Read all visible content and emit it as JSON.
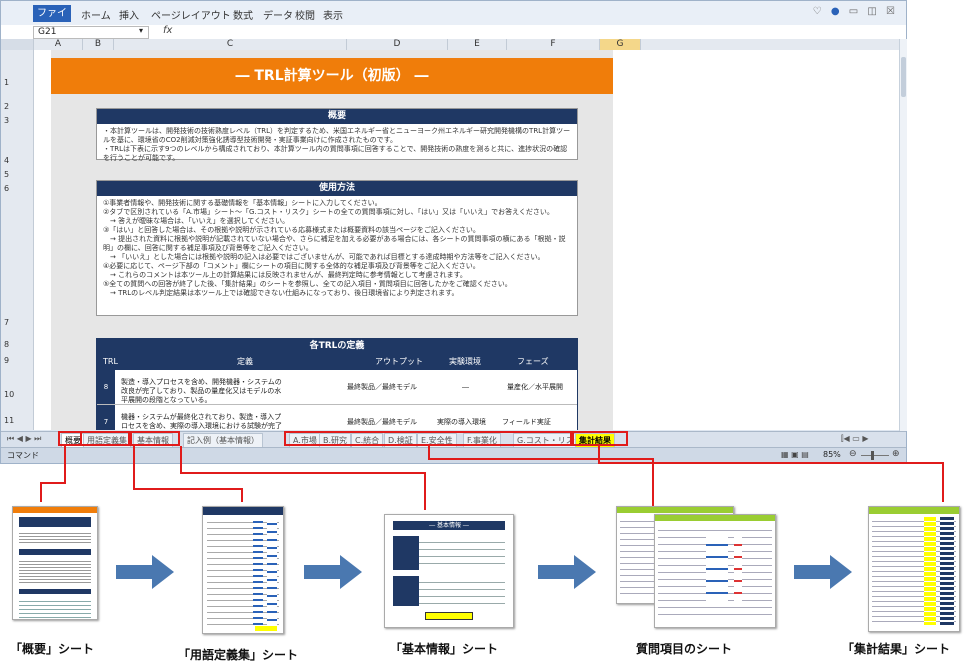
{
  "ribbon": {
    "file_tab": "ファイル",
    "tabs": [
      "ホーム",
      "挿入",
      "ページレイアウト",
      "数式",
      "データ",
      "校閲",
      "表示"
    ]
  },
  "formula_bar": {
    "name_box": "G21",
    "fx": "fx"
  },
  "columns": [
    "A",
    "B",
    "C",
    "D",
    "E",
    "F",
    "G"
  ],
  "rows": [
    "1",
    "2",
    "3",
    "4",
    "5",
    "6",
    "7",
    "8",
    "9",
    "10",
    "11"
  ],
  "sheet": {
    "title": "― TRL計算ツール（初版） ―",
    "overview_heading": "概要",
    "overview_text": "・本計算ツールは、開発技術の技術熟度レベル（TRL）を判定するため、米国エネルギー省とニューヨーク州エネルギー研究開発機構のTRL計算ツールを基に、環境省のCO2削減対策強化誘導型技術開発・実証事業向けに作成されたものです。\n・TRLは下表に示す9つのレベルから構成されており、本計算ツール内の質問事項に回答することで、開発技術の熟度を測ると共に、進捗状況の確認を行うことが可能です。",
    "usage_heading": "使用方法",
    "usage_text": "①事業者情報や、開発技術に関する基礎情報を「基本情報」シートに入力してください。\n②タブで区別されている「A.市場」シート～「G.コスト・リスク」シートの全ての質問事項に対し、「はい」又は「いいえ」でお答えください。\n　→ 答えが曖昧な場合は、「いいえ」を選択してください。\n③「はい」と回答した場合は、その根拠や説明が示されている応募様式または概要資料の該当ページをご記入ください。\n　→ 提出された資料に根拠や説明が記載されていない場合や、さらに補足を加える必要がある場合には、各シートの質問事項の横にある「根拠・説明」の欄に、回答に関する補足事項及び背景等をご記入ください。\n　→ 「いいえ」とした場合には根拠や説明の記入は必要ではございませんが、可能であれば目標とする達成時期や方法等をご記入ください。\n④必要に応じて、ページ下部の「コメント」欄にシートの項目に関する全体的な補足事項及び背景等をご記入ください。\n　→ これらのコメントは本ツール上の計算結果には反映されませんが、最終判定時に参考情報として考慮されます。\n⑤全ての質問への回答が終了した後、「集計結果」のシートを参照し、全ての記入項目・質問項目に回答したかをご確認ください。\n　→ TRLのレベル判定結果は本ツール上では確認できない仕組みになっており、後日環境省により判定されます。",
    "trl_heading": "各TRLの定義",
    "trl_headers": [
      "TRL",
      "定義",
      "アウトプット",
      "実験環境",
      "フェーズ"
    ],
    "trl_rows": [
      {
        "trl": "8",
        "definition": "製造・導入プロセスを含め、開発機器・システムの改良が完了しており、製品の量産化又はモデルの水平展開の段階となっている。",
        "output": "最終製品／最終モデル",
        "env": "―",
        "phase": "量産化／水平展開"
      },
      {
        "trl": "7",
        "definition": "機器・システムが最終化されており、製造・導入プロセスを含め、実際の導入環境における試験が完了している。",
        "output": "最終製品／最終モデル",
        "env": "実際の導入環境",
        "phase": "フィールド実証"
      }
    ]
  },
  "sheet_tabs": [
    "概要",
    "用語定義集",
    "基本情報",
    "記入例（基本情報）",
    "A.市場",
    "B.研究",
    "C.統合",
    "D.検証",
    "E.安全性",
    "F.事業化",
    "G.コスト・リスク",
    "集計結果"
  ],
  "status": {
    "mode": "コマンド",
    "zoom": "85%"
  },
  "captions": [
    "「概要」シート",
    "「用語定義集」シート",
    "「基本情報」シート",
    "質問項目のシート",
    "「集計結果」シート"
  ],
  "thumbnail_titles": {
    "basic_info": "― 基本情報 ―"
  },
  "colors": {
    "accent_orange": "#f07d0a",
    "header_navy": "#1f3864",
    "highlight_red": "#e01b1b",
    "tab_yellow": "#ffff00",
    "arrow_blue": "#4a78b0"
  }
}
